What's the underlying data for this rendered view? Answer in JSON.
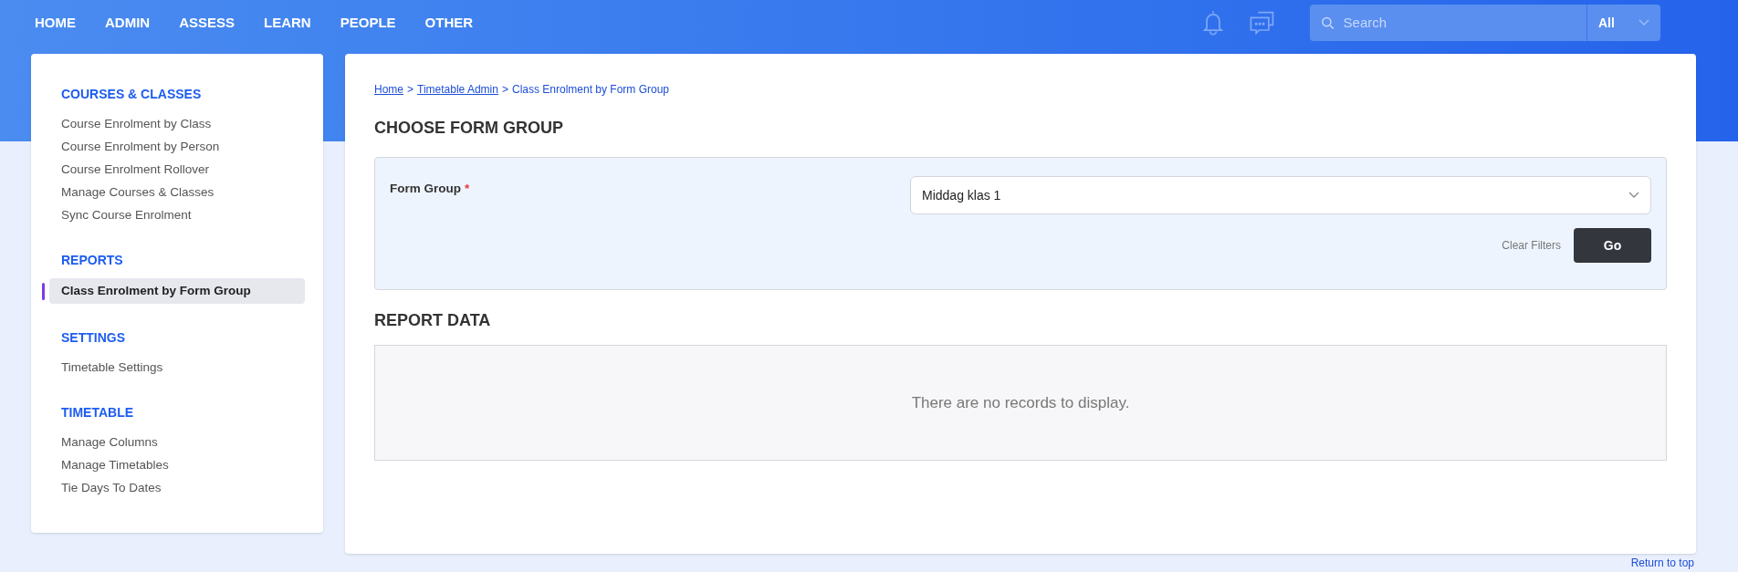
{
  "nav": {
    "items": [
      {
        "label": "HOME"
      },
      {
        "label": "ADMIN"
      },
      {
        "label": "ASSESS"
      },
      {
        "label": "LEARN"
      },
      {
        "label": "PEOPLE"
      },
      {
        "label": "OTHER"
      }
    ]
  },
  "search": {
    "placeholder": "Search",
    "scope": "All"
  },
  "sidebar": {
    "sections": [
      {
        "title": "COURSES & CLASSES",
        "items": [
          {
            "label": "Course Enrolment by Class",
            "selected": false
          },
          {
            "label": "Course Enrolment by Person",
            "selected": false
          },
          {
            "label": "Course Enrolment Rollover",
            "selected": false
          },
          {
            "label": "Manage Courses & Classes",
            "selected": false
          },
          {
            "label": "Sync Course Enrolment",
            "selected": false
          }
        ]
      },
      {
        "title": "REPORTS",
        "items": [
          {
            "label": "Class Enrolment by Form Group",
            "selected": true
          }
        ]
      },
      {
        "title": "SETTINGS",
        "items": [
          {
            "label": "Timetable Settings",
            "selected": false
          }
        ]
      },
      {
        "title": "TIMETABLE",
        "items": [
          {
            "label": "Manage Columns",
            "selected": false
          },
          {
            "label": "Manage Timetables",
            "selected": false
          },
          {
            "label": "Tie Days To Dates",
            "selected": false
          }
        ]
      }
    ]
  },
  "breadcrumb_separator": ">",
  "breadcrumb": [
    {
      "label": "Home",
      "kind": "link"
    },
    {
      "label": "Timetable Admin",
      "kind": "link"
    },
    {
      "label": "Class Enrolment by Form Group",
      "kind": "current"
    }
  ],
  "filter": {
    "title": "CHOOSE FORM GROUP",
    "label": "Form Group",
    "required_mark": "*",
    "value": "Middag klas 1",
    "clear": "Clear Filters",
    "submit": "Go"
  },
  "report": {
    "title": "REPORT DATA",
    "empty": "There are no records to display."
  },
  "footer": {
    "link": "Return to top"
  }
}
